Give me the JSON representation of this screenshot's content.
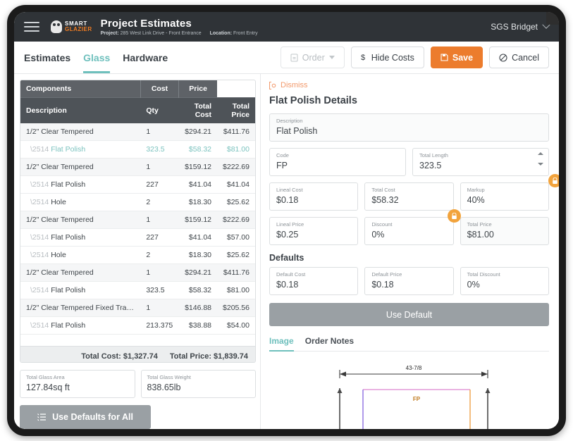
{
  "appbar": {
    "menu_icon": "hamburger-icon",
    "logo_top": "SMART",
    "logo_bottom": "GLAZIER",
    "title": "Project Estimates",
    "project_label": "Project:",
    "project_value": "285 West Link Drive - Front Entrance",
    "location_label": "Location:",
    "location_value": "Front Entry",
    "user": "SGS Bridget"
  },
  "tabs": [
    {
      "label": "Estimates",
      "active": false
    },
    {
      "label": "Glass",
      "active": true
    },
    {
      "label": "Hardware",
      "active": false
    }
  ],
  "toolbar": {
    "order_label": "Order",
    "hide_costs_label": "Hide Costs",
    "save_label": "Save",
    "cancel_label": "Cancel"
  },
  "table": {
    "group_headers": [
      "Components",
      "Cost",
      "Price"
    ],
    "columns": [
      "Description",
      "Qty",
      "Total Cost",
      "Total Price"
    ],
    "rows": [
      {
        "desc": "1/2\" Clear Tempered",
        "qty": "1",
        "cost": "$294.21",
        "price": "$411.76",
        "child": false,
        "selected": false
      },
      {
        "desc": "Flat Polish",
        "qty": "323.5",
        "cost": "$58.32",
        "price": "$81.00",
        "child": true,
        "selected": true
      },
      {
        "desc": "1/2\" Clear Tempered",
        "qty": "1",
        "cost": "$159.12",
        "price": "$222.69",
        "child": false,
        "selected": false
      },
      {
        "desc": "Flat Polish",
        "qty": "227",
        "cost": "$41.04",
        "price": "$41.04",
        "child": true,
        "selected": false
      },
      {
        "desc": "Hole",
        "qty": "2",
        "cost": "$18.30",
        "price": "$25.62",
        "child": true,
        "selected": false
      },
      {
        "desc": "1/2\" Clear Tempered",
        "qty": "1",
        "cost": "$159.12",
        "price": "$222.69",
        "child": false,
        "selected": false
      },
      {
        "desc": "Flat Polish",
        "qty": "227",
        "cost": "$41.04",
        "price": "$57.00",
        "child": true,
        "selected": false
      },
      {
        "desc": "Hole",
        "qty": "2",
        "cost": "$18.30",
        "price": "$25.62",
        "child": true,
        "selected": false
      },
      {
        "desc": "1/2\" Clear Tempered",
        "qty": "1",
        "cost": "$294.21",
        "price": "$411.76",
        "child": false,
        "selected": false
      },
      {
        "desc": "Flat Polish",
        "qty": "323.5",
        "cost": "$58.32",
        "price": "$81.00",
        "child": true,
        "selected": false
      },
      {
        "desc": "1/2\" Clear Tempered Fixed Trans...",
        "qty": "1",
        "cost": "$146.88",
        "price": "$205.56",
        "child": false,
        "selected": false
      },
      {
        "desc": "Flat Polish",
        "qty": "213.375",
        "cost": "$38.88",
        "price": "$54.00",
        "child": true,
        "selected": false
      }
    ],
    "total_cost": "Total Cost: $1,327.74",
    "total_price": "Total Price: $1,839.74"
  },
  "summary": {
    "area_label": "Total Glass Area",
    "area_value": "127.84sq ft",
    "weight_label": "Total Glass Weight",
    "weight_value": "838.65lb",
    "use_defaults_all": "Use Defaults for All"
  },
  "details": {
    "dismiss": "Dismiss",
    "title": "Flat Polish Details",
    "description_label": "Description",
    "description_value": "Flat Polish",
    "code_label": "Code",
    "code_value": "FP",
    "total_length_label": "Total Length",
    "total_length_value": "323.5",
    "lineal_cost_label": "Lineal Cost",
    "lineal_cost_value": "$0.18",
    "total_cost_label": "Total Cost",
    "total_cost_value": "$58.32",
    "markup_label": "Markup",
    "markup_value": "40%",
    "lineal_price_label": "Lineal Price",
    "lineal_price_value": "$0.25",
    "discount_label": "Discount",
    "discount_value": "0%",
    "total_price_label": "Total Price",
    "total_price_value": "$81.00",
    "defaults_title": "Defaults",
    "default_cost_label": "Default Cost",
    "default_cost_value": "$0.18",
    "default_price_label": "Default Price",
    "default_price_value": "$0.18",
    "total_discount_label": "Total Discount",
    "total_discount_value": "0%",
    "use_default": "Use Default",
    "subtabs": [
      {
        "label": "Image",
        "active": true
      },
      {
        "label": "Order Notes",
        "active": false
      }
    ],
    "drawing": {
      "dimension": "43-7/8",
      "panel_label": "FP"
    }
  },
  "colors": {
    "accent_orange": "#ec7c2d",
    "accent_teal": "#6fc0bd",
    "appbar_bg": "#2f3337",
    "lock_badge": "#f2a33c"
  }
}
